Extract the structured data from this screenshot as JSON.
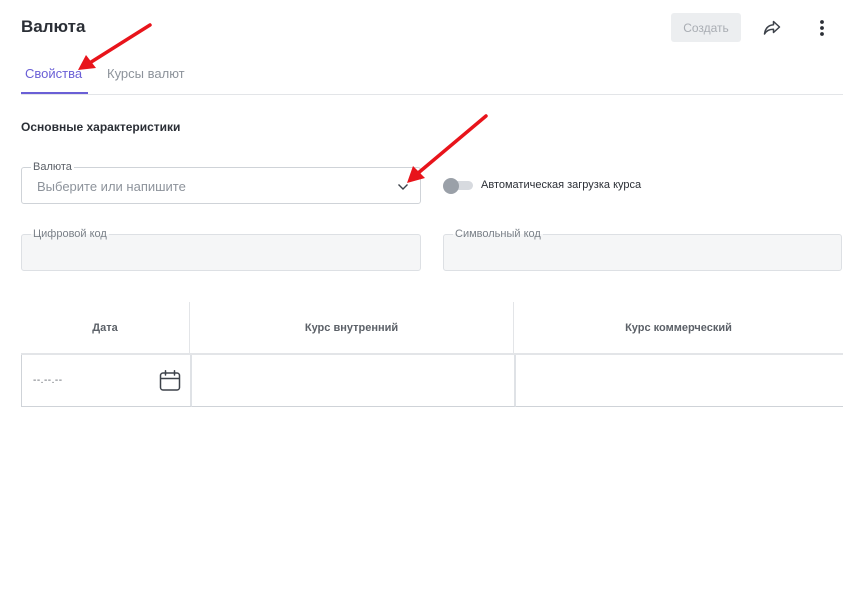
{
  "header": {
    "title": "Валюта",
    "create_label": "Создать",
    "share_icon": "share-icon",
    "more_icon": "more-vertical-icon"
  },
  "tabs": [
    {
      "label": "Свойства",
      "active": true
    },
    {
      "label": "Курсы валют",
      "active": false
    }
  ],
  "section": {
    "title": "Основные характеристики"
  },
  "currency_field": {
    "label": "Валюта",
    "placeholder": "Выберите или напишите",
    "value": ""
  },
  "auto_load": {
    "label": "Автоматическая загрузка курса",
    "enabled": false
  },
  "numeric_code_field": {
    "label": "Цифровой код",
    "value": ""
  },
  "symbol_code_field": {
    "label": "Символьный код",
    "value": ""
  },
  "rates_table": {
    "columns": [
      "Дата",
      "Курс внутренний",
      "Курс коммерческий"
    ],
    "rows": [
      {
        "date": "--.--.--",
        "internal_rate": "",
        "commercial_rate": ""
      }
    ]
  },
  "colors": {
    "accent": "#6a5fd6",
    "annotation": "#e8141b",
    "disabled_button_bg": "#eceef0"
  }
}
